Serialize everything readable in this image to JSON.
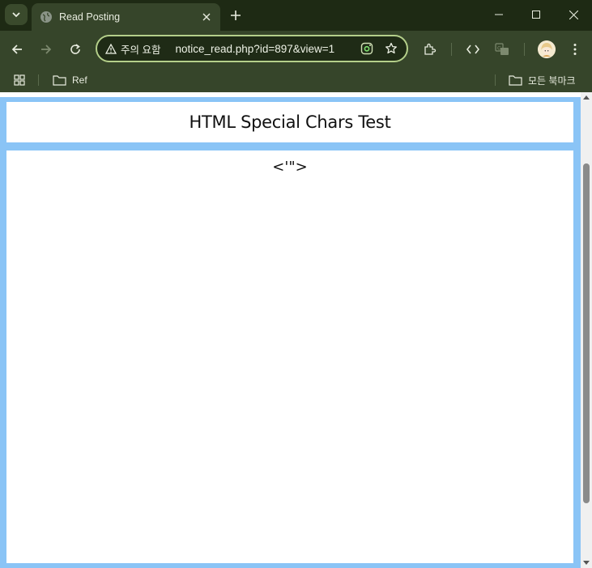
{
  "browser": {
    "tab": {
      "title": "Read Posting"
    },
    "address_bar": {
      "security_label": "주의 요함",
      "url": "notice_read.php?id=897&view=1"
    },
    "bookmarks": [
      {
        "label": "Ref"
      }
    ],
    "all_bookmarks_label": "모든 북마크"
  },
  "page": {
    "title": "HTML Special Chars Test",
    "content": "<'\">"
  },
  "colors": {
    "frame_blue": "#8ac4f6",
    "omnibox_border": "#b4cf8a",
    "chrome_green": "#36452a"
  }
}
